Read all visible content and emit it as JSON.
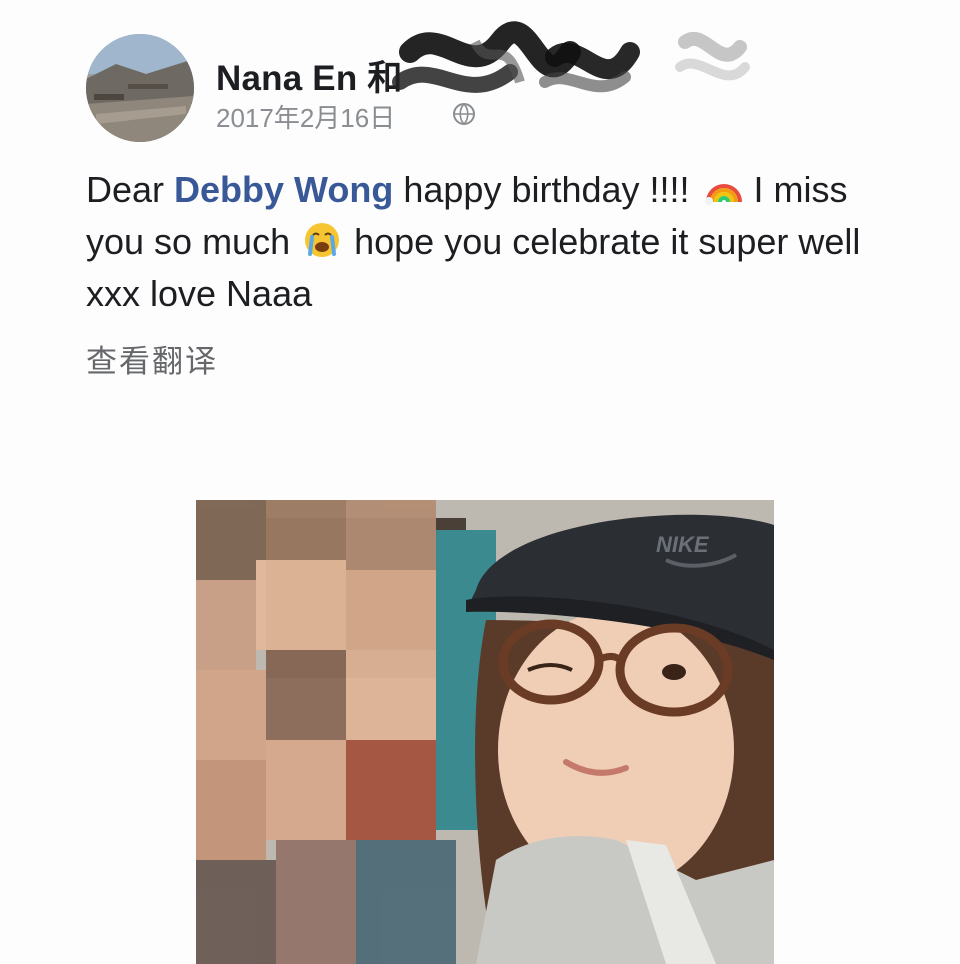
{
  "post": {
    "author": "Nana En 和",
    "date": "2017年2月16日",
    "message_parts": {
      "before_mention": "Dear ",
      "mention": "Debby Wong",
      "after_mention": " happy birthday !!!! ",
      "after_rainbow": " I miss you so much ",
      "after_crying": " hope you celebrate it super well xxx love Naaa"
    },
    "translate_link": "查看翻译",
    "photo_logo": "NIKE"
  },
  "icons": {
    "audience": "globe-icon",
    "rainbow": "rainbow-emoji",
    "crying": "crying-face-emoji"
  },
  "colors": {
    "mention": "#385898",
    "secondary_text": "#8a8d91",
    "translate": "#65676b"
  }
}
